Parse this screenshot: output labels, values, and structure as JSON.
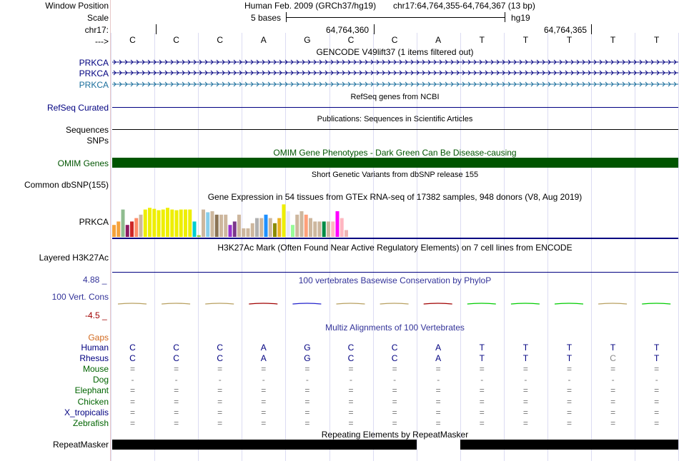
{
  "header": {
    "window_position_label": "Window Position",
    "assembly_text": "Human Feb. 2009 (GRCh37/hg19)",
    "position_text": "chr17:64,764,355-64,764,367 (13 bp)",
    "scale_label": "Scale",
    "scale_bases": "5 bases",
    "scale_db": "hg19",
    "chrom_label": "chr17:",
    "tick_1": "64,764,360",
    "tick_2": "64,764,365",
    "strand_label": "--->"
  },
  "sequence": [
    "C",
    "C",
    "C",
    "A",
    "G",
    "C",
    "C",
    "A",
    "T",
    "T",
    "T",
    "T",
    "T"
  ],
  "tracks": {
    "gencode_title": "GENCODE V49lift37 (1 items filtered out)",
    "gencode_items": [
      "PRKCA",
      "PRKCA",
      "PRKCA"
    ],
    "refseq_title": "RefSeq genes from NCBI",
    "refseq_label": "RefSeq Curated",
    "pubs_title": "Publications: Sequences in Scientific Articles",
    "pubs_label": "Sequences",
    "snps_label": "SNPs",
    "omim_title": "OMIM Gene Phenotypes - Dark Green Can Be Disease-causing",
    "omim_label": "OMIM Genes",
    "dbsnp_title": "Short Genetic Variants from dbSNP release 155",
    "dbsnp_label": "Common dbSNP(155)",
    "gtex_title": "Gene Expression in 54 tissues from GTEx RNA-seq of 17382 samples, 948 donors (V8, Aug 2019)",
    "gtex_label": "PRKCA",
    "h3k_title": "H3K27Ac Mark (Often Found Near Active Regulatory Elements) on 7 cell lines from ENCODE",
    "h3k_label": "Layered H3K27Ac",
    "cons_title": "100 vertebrates Basewise Conservation by PhyloP",
    "cons_label": "100 Vert. Cons",
    "cons_max": "4.88 _",
    "cons_min": "-4.5 _",
    "multiz_title": "Multiz Alignments of 100 Vertebrates",
    "gaps_label": "Gaps",
    "rmsk_title": "Repeating Elements by RepeatMasker",
    "rmsk_label": "RepeatMasker"
  },
  "gtex_bars": {
    "heights": [
      0.35,
      0.45,
      0.8,
      0.35,
      0.45,
      0.55,
      0.65,
      0.8,
      0.85,
      0.82,
      0.78,
      0.8,
      0.85,
      0.8,
      0.78,
      0.8,
      0.8,
      0.8,
      0.45,
      0.05,
      0.8,
      0.72,
      0.75,
      0.65,
      0.65,
      0.65,
      0.35,
      0.45,
      0.65,
      0.25,
      0.25,
      0.4,
      0.55,
      0.55,
      0.65,
      0.55,
      0.4,
      0.55,
      0.95,
      0.75,
      0.35,
      0.65,
      0.75,
      0.65,
      0.55,
      0.45,
      0.45,
      0.45,
      0.45,
      0.45,
      0.75,
      0.55,
      0.2
    ],
    "colors": [
      "#f5a23c",
      "#f5a23c",
      "#8fbc8f",
      "#8b1a62",
      "#cd2626",
      "#ff8c69",
      "#cdb79e",
      "#eeee00",
      "#eeee00",
      "#eeee00",
      "#eeee00",
      "#eeee00",
      "#eeee00",
      "#eeee00",
      "#eeee00",
      "#eeee00",
      "#eeee00",
      "#eeee00",
      "#00ced1",
      "#9acd32",
      "#cdb79e",
      "#87ceeb",
      "#cdb79e",
      "#8b7355",
      "#cdb79e",
      "#cdb79e",
      "#9932cc",
      "#7a378b",
      "#cdb79e",
      "#cdb79e",
      "#cdb79e",
      "#cdb79e",
      "#b0b0b0",
      "#cdb79e",
      "#1e90ff",
      "#cdb79e",
      "#8b8b00",
      "#eeb422",
      "#eeee00",
      "#e6e6fa",
      "#98fb98",
      "#cdb79e",
      "#cdb79e",
      "#ffa07a",
      "#cdb79e",
      "#cdb79e",
      "#cdb79e",
      "#008b45",
      "#cdb79e",
      "#ffb6c1",
      "#ff00ff",
      "#ffb6c1",
      "#eeb4b4"
    ]
  },
  "multiz": {
    "species": [
      {
        "name": "Human",
        "color": "#000080",
        "seq": [
          "C",
          "C",
          "C",
          "A",
          "G",
          "C",
          "C",
          "A",
          "T",
          "T",
          "T",
          "T",
          "T"
        ]
      },
      {
        "name": "Rhesus",
        "color": "#000080",
        "seq": [
          "C",
          "C",
          "C",
          "A",
          "G",
          "C",
          "C",
          "A",
          "T",
          "T",
          "T",
          "C",
          "T"
        ]
      },
      {
        "name": "Mouse",
        "color": "#006400",
        "seq": [
          "=",
          "=",
          "=",
          "=",
          "=",
          "=",
          "=",
          "=",
          "=",
          "=",
          "=",
          "=",
          "="
        ]
      },
      {
        "name": "Dog",
        "color": "#006400",
        "seq": [
          "-",
          "-",
          "-",
          "-",
          "-",
          "-",
          "-",
          "-",
          "-",
          "-",
          "-",
          "-",
          "-"
        ]
      },
      {
        "name": "Elephant",
        "color": "#006400",
        "seq": [
          "=",
          "=",
          "=",
          "=",
          "=",
          "=",
          "=",
          "=",
          "=",
          "=",
          "=",
          "=",
          "="
        ]
      },
      {
        "name": "Chicken",
        "color": "#006400",
        "seq": [
          "=",
          "=",
          "=",
          "=",
          "=",
          "=",
          "=",
          "=",
          "=",
          "=",
          "=",
          "=",
          "="
        ]
      },
      {
        "name": "X_tropicalis",
        "color": "#000080",
        "seq": [
          "=",
          "=",
          "=",
          "=",
          "=",
          "=",
          "=",
          "=",
          "=",
          "=",
          "=",
          "=",
          "="
        ]
      },
      {
        "name": "Zebrafish",
        "color": "#006400",
        "seq": [
          "=",
          "=",
          "=",
          "=",
          "=",
          "=",
          "=",
          "=",
          "=",
          "=",
          "=",
          "=",
          "="
        ]
      }
    ]
  },
  "colors": {
    "gene_blue": "#000080",
    "gene_light": "#1a6e9c",
    "omim_green": "#005500",
    "gaps_orange": "#d2691e",
    "cons_blue": "#333399",
    "cons_red": "#a00000",
    "grid_line": "#d8d8f0"
  }
}
